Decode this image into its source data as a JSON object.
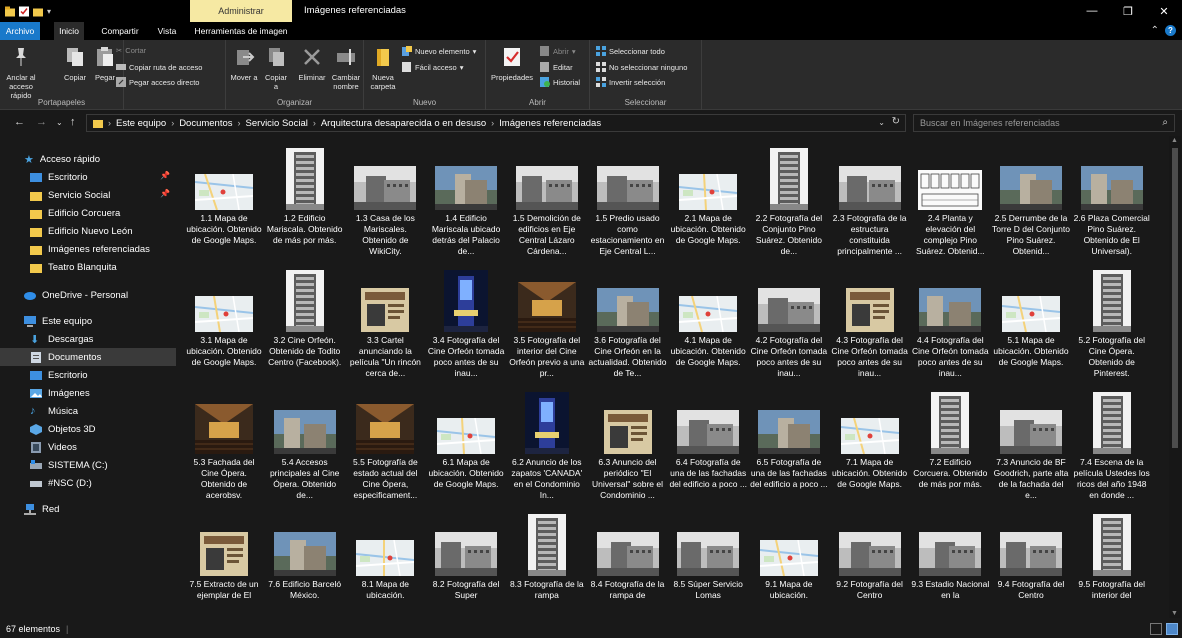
{
  "window": {
    "contextual_tab": "Administrar",
    "title": "Imágenes referenciadas",
    "controls": {
      "minimize": "—",
      "maximize": "❐",
      "close": "✕"
    }
  },
  "tabs": [
    "Archivo",
    "Inicio",
    "Compartir",
    "Vista",
    "Herramientas de imagen"
  ],
  "ribbon": {
    "portapapeles": {
      "label": "Portapapeles",
      "pin": "Anclar al acceso rápido",
      "copy": "Copiar",
      "paste": "Pegar",
      "cut": "Cortar",
      "copy_path": "Copiar ruta de acceso",
      "paste_shortcut": "Pegar acceso directo"
    },
    "organizar": {
      "label": "Organizar",
      "move": "Mover a",
      "copy_to": "Copiar a",
      "delete": "Eliminar",
      "rename": "Cambiar nombre"
    },
    "nuevo": {
      "label": "Nuevo",
      "new_folder": "Nueva carpeta",
      "new_item": "Nuevo elemento",
      "easy_access": "Fácil acceso"
    },
    "abrir": {
      "label": "Abrir",
      "properties": "Propiedades",
      "open": "Abrir",
      "edit": "Editar",
      "history": "Historial"
    },
    "seleccionar": {
      "label": "Seleccionar",
      "select_all": "Seleccionar todo",
      "select_none": "No seleccionar ninguno",
      "invert": "Invertir selección"
    }
  },
  "address": {
    "crumbs": [
      "Este equipo",
      "Documentos",
      "Servicio Social",
      "Arquitectura desaparecida o en desuso",
      "Imágenes referenciadas"
    ],
    "search_placeholder": "Buscar en Imágenes referenciadas"
  },
  "nav": {
    "quick_access": "Acceso rápido",
    "quick_items": [
      "Escritorio",
      "Servicio Social",
      "Edificio Corcuera",
      "Edificio Nuevo León",
      "Imágenes referenciadas",
      "Teatro Blanquita"
    ],
    "onedrive": "OneDrive - Personal",
    "this_pc": "Este equipo",
    "pc_items": [
      "Descargas",
      "Documentos",
      "Escritorio",
      "Imágenes",
      "Música",
      "Objetos 3D",
      "Videos",
      "SISTEMA (C:)",
      "#NSC (D:)"
    ],
    "network": "Red"
  },
  "files": [
    {
      "caption": "1.1 Mapa de ubicación. Obtenido de Google Maps.",
      "kind": "map"
    },
    {
      "caption": "1.2 Edificio Mariscala. Obtenido de más por más.",
      "kind": "tall"
    },
    {
      "caption": "1.3 Casa de los Mariscales. Obtenido de WikiCity.",
      "kind": "bw"
    },
    {
      "caption": "1.4 Edificio Mariscala ubicado detrás del Palacio de...",
      "kind": "photo"
    },
    {
      "caption": "1.5 Demolición de edificios en Eje Central Lázaro Cárdena...",
      "kind": "bw"
    },
    {
      "caption": "1.5 Predio usado como estacionamiento en Eje Central L...",
      "kind": "bw"
    },
    {
      "caption": "2.1 Mapa de ubicación. Obtenido de Google Maps.",
      "kind": "map"
    },
    {
      "caption": "2.2 Fotografía del Conjunto Pino Suárez. Obtenido de...",
      "kind": "tall"
    },
    {
      "caption": "2.3 Fotografía de la estructura constituida principalmente ...",
      "kind": "bw"
    },
    {
      "caption": "2.4 Planta y elevación del complejo Pino Suárez. Obtenid...",
      "kind": "plan"
    },
    {
      "caption": "2.5 Derrumbe de la Torre D del Conjunto Pino Suárez. Obtenid...",
      "kind": "photo"
    },
    {
      "caption": "2.6 Plaza Comercial Pino Suárez. Obtenido de El Universal).",
      "kind": "photo"
    },
    {
      "caption": "3.1 Mapa de ubicación. Obtenido de Google Maps.",
      "kind": "map"
    },
    {
      "caption": "3.2 Cine Orfeón. Obtenido de Todito Centro (Facebook).",
      "kind": "tall"
    },
    {
      "caption": "3.3 Cartel anunciando la película \"Un rincón cerca de...",
      "kind": "poster"
    },
    {
      "caption": "3.4 Fotografía del Cine Orfeón tomada poco antes de su inau...",
      "kind": "night"
    },
    {
      "caption": "3.5 Fotografía del interior del Cine Orfeón previo a una pr...",
      "kind": "interior"
    },
    {
      "caption": "3.6 Fotografía del Cine Orfeón en la actualidad. Obtenido de Te...",
      "kind": "photo"
    },
    {
      "caption": "4.1 Mapa de ubicación. Obtenido de Google Maps.",
      "kind": "map"
    },
    {
      "caption": "4.2 Fotografía del Cine Orfeón tomada poco antes de su inau...",
      "kind": "bw"
    },
    {
      "caption": "4.3 Fotografía del Cine Orfeón tomada poco antes de su inau...",
      "kind": "poster"
    },
    {
      "caption": "4.4 Fotografía del Cine Orfeón tomada poco antes de su inau...",
      "kind": "photo"
    },
    {
      "caption": "5.1 Mapa de ubicación. Obtenido de Google Maps.",
      "kind": "map"
    },
    {
      "caption": "5.2 Fotografía del Cine Ópera. Obtenido de Pinterest.",
      "kind": "tall"
    },
    {
      "caption": "5.3 Fachada del Cine Ópera. Obtenido de acerobsv.",
      "kind": "interior"
    },
    {
      "caption": "5.4 Accesos principales al Cine Ópera. Obtenido de...",
      "kind": "photo"
    },
    {
      "caption": "5.5 Fotografía de estado actual del Cine Ópera, especificament...",
      "kind": "interior"
    },
    {
      "caption": "6.1 Mapa de ubicación. Obtenido de Google Maps.",
      "kind": "map"
    },
    {
      "caption": "6.2 Anuncio de los zapatos 'CANADA' en el Condominio In...",
      "kind": "night"
    },
    {
      "caption": "6.3 Anuncio del periódico \"El Universal\" sobre el Condominio ...",
      "kind": "poster"
    },
    {
      "caption": "6.4 Fotografía de una de las fachadas del edificio a poco ...",
      "kind": "bw"
    },
    {
      "caption": "6.5 Fotografía de una de las fachadas del edificio a poco ...",
      "kind": "photo"
    },
    {
      "caption": "7.1 Mapa de ubicación. Obtenido de Google Maps.",
      "kind": "map"
    },
    {
      "caption": "7.2 Edificio Corcuera. Obtenido de más por más.",
      "kind": "tall"
    },
    {
      "caption": "7.3 Anuncio de BF Goodrich, parte alta de la fachada del e...",
      "kind": "bw"
    },
    {
      "caption": "7.4 Escena de la película Ustedes los ricos del año 1948 en donde ...",
      "kind": "tall"
    },
    {
      "caption": "7.5 Extracto de un ejemplar de El",
      "kind": "poster"
    },
    {
      "caption": "7.6 Edificio Barceló México.",
      "kind": "photo"
    },
    {
      "caption": "8.1 Mapa de ubicación.",
      "kind": "map"
    },
    {
      "caption": "8.2 Fotografía del Super",
      "kind": "bw"
    },
    {
      "caption": "8.3 Fotografía de la rampa",
      "kind": "tall"
    },
    {
      "caption": "8.4 Fotografía de la rampa de",
      "kind": "bw"
    },
    {
      "caption": "8.5 Súper Servicio Lomas",
      "kind": "bw"
    },
    {
      "caption": "9.1 Mapa de ubicación.",
      "kind": "map"
    },
    {
      "caption": "9.2 Fotografía del Centro",
      "kind": "bw"
    },
    {
      "caption": "9.3 Estadio Nacional en la",
      "kind": "bw"
    },
    {
      "caption": "9.4 Fotografía del Centro",
      "kind": "bw"
    },
    {
      "caption": "9.5 Fotografía del interior del",
      "kind": "tall"
    }
  ],
  "status": {
    "count": "67 elementos"
  },
  "colors": {
    "accent": "#1979ca",
    "contextual": "#f6e9a3",
    "folder": "#f2c94c"
  }
}
